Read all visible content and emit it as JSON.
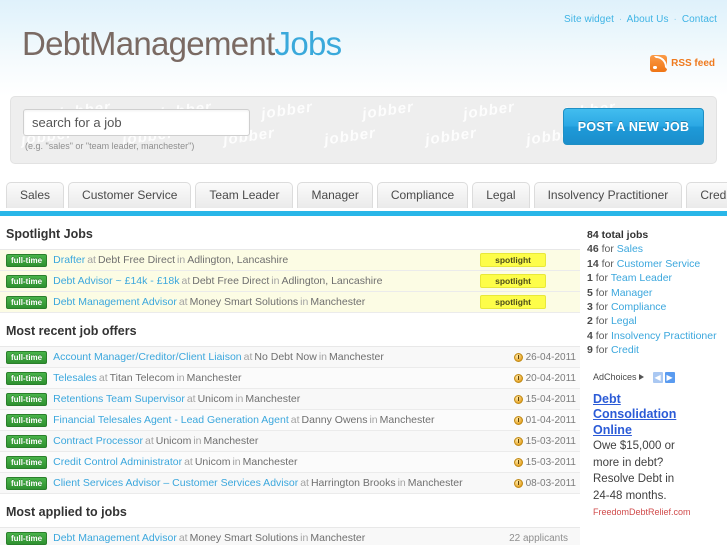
{
  "header": {
    "toplinks": [
      {
        "label": "Site widget"
      },
      {
        "label": "About Us"
      },
      {
        "label": "Contact"
      }
    ],
    "separator": "·",
    "logo": {
      "part1": "DebtManagement",
      "part2": "Jobs"
    },
    "rss": {
      "label": "RSS feed",
      "icon": "rss-icon"
    },
    "colors": {
      "brand_blue": "#3aa9db",
      "logo_dark": "#7a6a63",
      "accent_bar": "#29b6e8"
    }
  },
  "search": {
    "value": "search for a job",
    "placeholder": "search for a job",
    "hint": "(e.g. \"sales\" or \"team leader, manchester\")",
    "post_button": "POST A NEW JOB",
    "watermark_word": "jobber"
  },
  "tabs": [
    {
      "label": "Sales"
    },
    {
      "label": "Customer Service"
    },
    {
      "label": "Team Leader"
    },
    {
      "label": "Manager"
    },
    {
      "label": "Compliance"
    },
    {
      "label": "Legal"
    },
    {
      "label": "Insolvency Practitioner"
    },
    {
      "label": "Credit"
    }
  ],
  "sections": {
    "spotlight": {
      "title": "Spotlight Jobs",
      "badge_label": "spotlight",
      "rows": [
        {
          "type": "full-time",
          "title": "Drafter",
          "at": "at",
          "company": "Debt Free Direct",
          "in": "in",
          "location": "Adlington, Lancashire",
          "badge": "spotlight"
        },
        {
          "type": "full-time",
          "title": "Debt Advisor ~ £14k - £18k",
          "at": "at",
          "company": "Debt Free Direct",
          "in": "in",
          "location": "Adlington, Lancashire",
          "badge": "spotlight"
        },
        {
          "type": "full-time",
          "title": "Debt Management Advisor",
          "at": "at",
          "company": "Money Smart Solutions",
          "in": "in",
          "location": "Manchester",
          "badge": "spotlight"
        }
      ]
    },
    "recent": {
      "title": "Most recent job offers",
      "rows": [
        {
          "type": "full-time",
          "title": "Account Manager/Creditor/Client Liaison",
          "at": "at",
          "company": "No Debt Now",
          "in": "in",
          "location": "Manchester",
          "date": "26-04-2011"
        },
        {
          "type": "full-time",
          "title": "Telesales",
          "at": "at",
          "company": "Titan Telecom",
          "in": "in",
          "location": "Manchester",
          "date": "20-04-2011"
        },
        {
          "type": "full-time",
          "title": "Retentions Team Supervisor",
          "at": "at",
          "company": "Unicom",
          "in": "in",
          "location": "Manchester",
          "date": "15-04-2011"
        },
        {
          "type": "full-time",
          "title": "Financial Telesales Agent - Lead Generation Agent",
          "at": "at",
          "company": "Danny Owens",
          "in": "in",
          "location": "Manchester",
          "date": "01-04-2011"
        },
        {
          "type": "full-time",
          "title": "Contract Processor",
          "at": "at",
          "company": "Unicom",
          "in": "in",
          "location": "Manchester",
          "date": "15-03-2011"
        },
        {
          "type": "full-time",
          "title": "Credit Control Administrator",
          "at": "at",
          "company": "Unicom",
          "in": "in",
          "location": "Manchester",
          "date": "15-03-2011"
        },
        {
          "type": "full-time",
          "title": "Client Services Advisor – Customer Services Advisor",
          "at": "at",
          "company": "Harrington Brooks",
          "in": "in",
          "location": "Manchester",
          "date": "08-03-2011"
        }
      ]
    },
    "applied": {
      "title": "Most applied to jobs",
      "rows": [
        {
          "type": "full-time",
          "title": "Debt Management Advisor",
          "at": "at",
          "company": "Money Smart Solutions",
          "in": "in",
          "location": "Manchester",
          "applicants": "22 applicants"
        }
      ]
    }
  },
  "sidebar": {
    "total_line": "84 total jobs",
    "for_word": "for",
    "counts": [
      {
        "count": "46",
        "label": "Sales"
      },
      {
        "count": "14",
        "label": "Customer Service"
      },
      {
        "count": "1",
        "label": "Team Leader"
      },
      {
        "count": "5",
        "label": "Manager"
      },
      {
        "count": "3",
        "label": "Compliance"
      },
      {
        "count": "2",
        "label": "Legal"
      },
      {
        "count": "4",
        "label": "Insolvency Practitioner"
      },
      {
        "count": "9",
        "label": "Credit"
      }
    ],
    "ad": {
      "adchoices_label": "AdChoices",
      "prev_arrow": "◀",
      "next_arrow": "▶",
      "headline_line1": "Debt",
      "headline_line2": "Consolidation",
      "headline_line3": "Online",
      "body_line1": "Owe $15,000 or",
      "body_line2": "more in debt?",
      "body_line3": "Resolve Debt in",
      "body_line4": "24-48 months.",
      "domain": "FreedomDebtRelief.com"
    }
  }
}
